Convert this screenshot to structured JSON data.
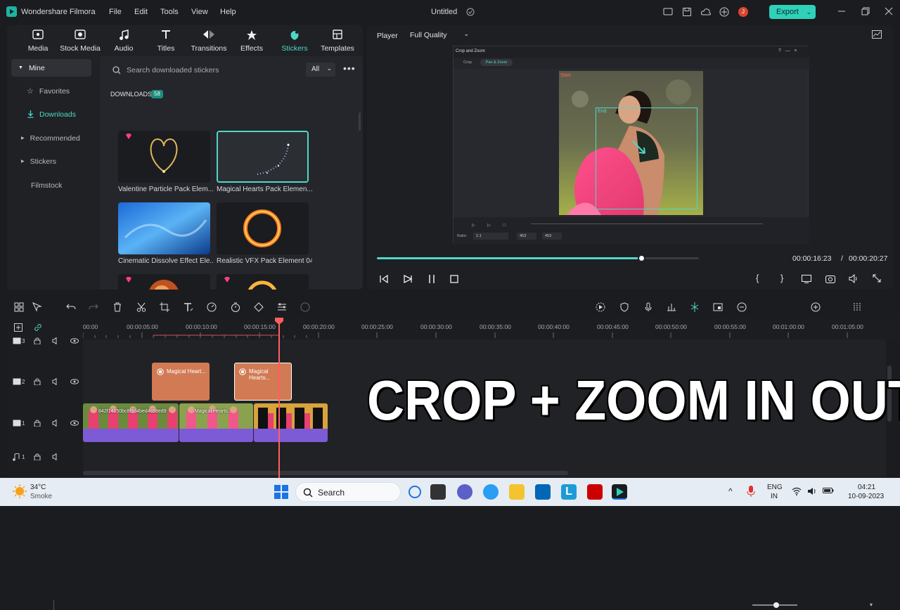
{
  "app": {
    "name": "Wondershare Filmora",
    "doc_title": "Untitled",
    "menu": [
      "File",
      "Edit",
      "Tools",
      "View",
      "Help"
    ],
    "export_label": "Export",
    "user_initial": "J"
  },
  "media_tabs": [
    {
      "label": "Media",
      "icon": "media-icon"
    },
    {
      "label": "Stock Media",
      "icon": "stock-media-icon"
    },
    {
      "label": "Audio",
      "icon": "music-note-icon"
    },
    {
      "label": "Titles",
      "icon": "text-icon"
    },
    {
      "label": "Transitions",
      "icon": "transitions-icon"
    },
    {
      "label": "Effects",
      "icon": "effects-icon"
    },
    {
      "label": "Stickers",
      "icon": "stickers-icon",
      "active": true
    },
    {
      "label": "Templates",
      "icon": "templates-icon"
    }
  ],
  "sidebar": {
    "items": [
      {
        "label": "Mine",
        "state": "expanded"
      },
      {
        "label": "Favorites"
      },
      {
        "label": "Downloads",
        "selected": true
      },
      {
        "label": "Recommended"
      },
      {
        "label": "Stickers"
      },
      {
        "label": "Filmstock"
      }
    ]
  },
  "stickers": {
    "search_placeholder": "Search downloaded stickers",
    "filter": "All",
    "section_title": "DOWNLOADS",
    "count": "58",
    "items": [
      {
        "label": "Valentine Particle Pack Elem...",
        "premium": true
      },
      {
        "label": "Magical Hearts Pack Elemen...",
        "premium": false,
        "selected": true
      },
      {
        "label": "Cinematic Dissolve Effect Ele...",
        "premium": false
      },
      {
        "label": "Realistic VFX Pack Element 04",
        "premium": false
      },
      {
        "label": "",
        "premium": true
      },
      {
        "label": "",
        "premium": true
      }
    ]
  },
  "player": {
    "label": "Player",
    "quality": "Full Quality",
    "current_time": "00:00:16:23",
    "separator": "/",
    "total_time": "00:00:20:27",
    "progress": 0.82
  },
  "inner_dialog": {
    "title": "Crop and Zoom",
    "tabs": [
      "Crop",
      "Pan & Zoom"
    ],
    "start_label": "Start",
    "end_label": "End",
    "ratio_label": "Ratio:",
    "ratio_value": "1:1",
    "width": "453",
    "height": "453"
  },
  "timeline": {
    "ticks": [
      "00:00",
      "00:00:05:00",
      "00:00:10:00",
      "00:00:15:00",
      "00:00:20:00",
      "00:00:25:00",
      "00:00:30:00",
      "00:00:35:00",
      "00:00:40:00",
      "00:00:45:00",
      "00:00:50:00",
      "00:00:55:00",
      "00:01:00:00",
      "00:01:05:00"
    ],
    "tracks": [
      {
        "num": "3",
        "type": "video"
      },
      {
        "num": "2",
        "type": "video"
      },
      {
        "num": "1",
        "type": "video"
      },
      {
        "num": "1",
        "type": "audio"
      }
    ],
    "sticker_clips": [
      "Magical Heart...",
      "Magical Hearts..."
    ],
    "video_clip_labels": [
      "842f14150bc8f5d4bed4c88ed9",
      "Magical Hearts..."
    ]
  },
  "caption": "CROP + ZOOM IN OUT",
  "taskbar": {
    "weather_temp": "34°C",
    "weather_desc": "Smoke",
    "search_label": "Search",
    "lang_top": "ENG",
    "lang_bottom": "IN",
    "time": "04:21",
    "date": "10-09-2023"
  },
  "colors": {
    "accent": "#4fd8c5",
    "clip_orange": "#d17a54",
    "video_clip": "#7e5bd6",
    "playhead": "#ff5f5f"
  }
}
